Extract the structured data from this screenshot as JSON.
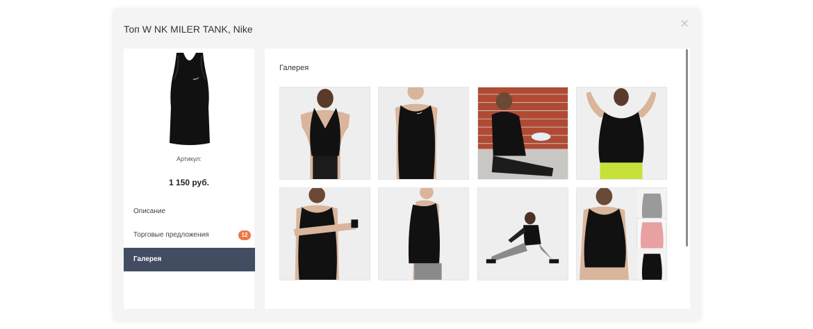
{
  "modal": {
    "title": "Топ W NK MILER TANK, Nike",
    "close_icon": "close-icon"
  },
  "product": {
    "image_icon": "tank-top-image",
    "article_label": "Артикул:",
    "price": "1 150 руб."
  },
  "nav": {
    "items": [
      {
        "label": "Описание"
      },
      {
        "label": "Торговые предложения",
        "badge": "12"
      },
      {
        "label": "Галерея",
        "active": true
      }
    ]
  },
  "gallery": {
    "title": "Галерея",
    "images": [
      "back-view-photo",
      "front-view-photo",
      "seated-brick-wall-photo",
      "arms-raised-photo",
      "arm-stretch-photo",
      "side-view-photo",
      "lunge-stretch-photo",
      "color-variants-collage-photo"
    ]
  },
  "colors": {
    "accent_badge": "#ee7747",
    "active_nav": "#434d62"
  }
}
